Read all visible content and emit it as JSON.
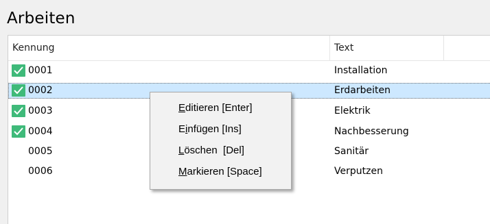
{
  "title": "Arbeiten",
  "columns": {
    "kennung": "Kennung",
    "text": "Text",
    "extra": ""
  },
  "rows": [
    {
      "id": "0001",
      "text": "Installation",
      "checked": true
    },
    {
      "id": "0002",
      "text": "Erdarbeiten",
      "checked": true,
      "selected": true
    },
    {
      "id": "0003",
      "text": "Elektrik",
      "checked": true
    },
    {
      "id": "0004",
      "text": "Nachbesserung",
      "checked": true
    },
    {
      "id": "0005",
      "text": "Sanitär",
      "checked": false
    },
    {
      "id": "0006",
      "text": "Verputzen",
      "checked": false
    }
  ],
  "context_menu": [
    {
      "accel": "E",
      "rest": "ditieren [Enter]"
    },
    {
      "pre": "E",
      "accel": "i",
      "rest": "nfügen [Ins]"
    },
    {
      "accel": "L",
      "rest": "öschen  [Del]"
    },
    {
      "accel": "M",
      "rest": "arkieren [Space]"
    }
  ],
  "colors": {
    "check": "#3fba7a",
    "selection": "#cde8ff"
  },
  "icons": {
    "check": "checkmark-icon"
  }
}
